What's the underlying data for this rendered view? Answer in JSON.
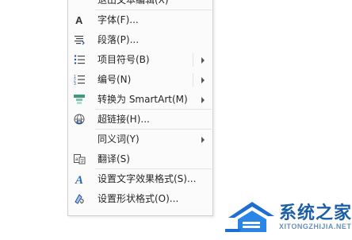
{
  "menu": {
    "items": [
      {
        "label": "退出文本编辑(X)",
        "icon": "none",
        "submenu": false
      },
      {
        "label": "字体(F)...",
        "icon": "font-icon",
        "submenu": false
      },
      {
        "label": "段落(P)...",
        "icon": "paragraph-icon",
        "submenu": false
      },
      {
        "label": "项目符号(B)",
        "icon": "bullets-icon",
        "submenu": true
      },
      {
        "label": "编号(N)",
        "icon": "numbering-icon",
        "submenu": true
      },
      {
        "label": "转换为 SmartArt(M)",
        "icon": "smartart-icon",
        "submenu": true
      },
      {
        "label": "超链接(H)...",
        "icon": "hyperlink-icon",
        "submenu": false
      },
      {
        "label": "同义词(Y)",
        "icon": "none",
        "submenu": true
      },
      {
        "label": "翻译(S)",
        "icon": "translate-icon",
        "submenu": false
      },
      {
        "label": "设置文字效果格式(S)...",
        "icon": "text-effect-icon",
        "submenu": false
      },
      {
        "label": "设置形状格式(O)...",
        "icon": "shape-format-icon",
        "submenu": false
      }
    ]
  },
  "watermark": {
    "text": "系统之家",
    "url": "XITONGZHIJIA.NET"
  },
  "colors": {
    "menu_bg": "#fbfbfb",
    "icon_blue": "#2b579a",
    "watermark_blue": "#1c5ea8"
  }
}
